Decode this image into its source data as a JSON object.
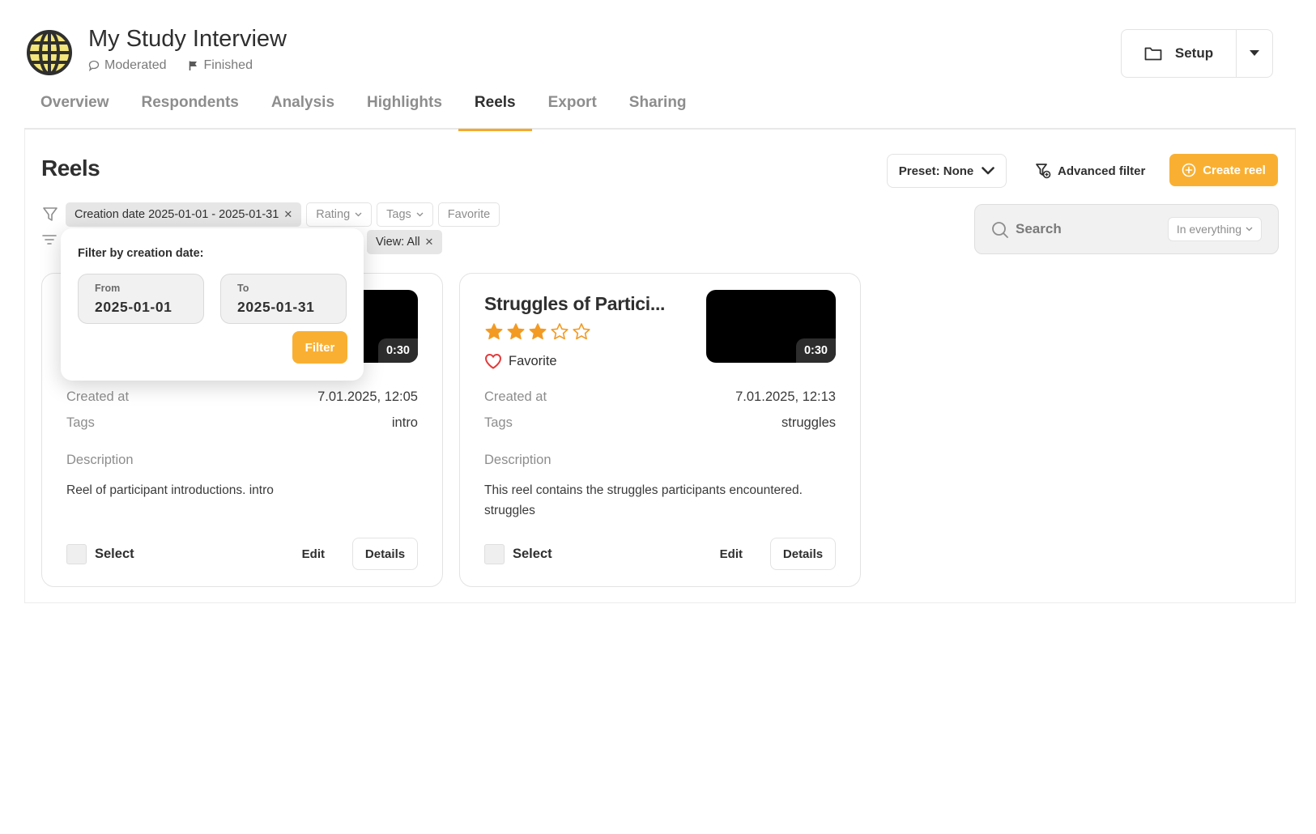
{
  "study": {
    "title": "My Study Interview",
    "mode": "Moderated",
    "status": "Finished",
    "setup_label": "Setup"
  },
  "tabs": [
    {
      "label": "Overview"
    },
    {
      "label": "Respondents"
    },
    {
      "label": "Analysis"
    },
    {
      "label": "Highlights"
    },
    {
      "label": "Reels",
      "active": true
    },
    {
      "label": "Export"
    },
    {
      "label": "Sharing"
    }
  ],
  "reels_page": {
    "heading": "Reels",
    "preset_label": "Preset: None",
    "advanced_filter_label": "Advanced filter",
    "create_label": "Create reel",
    "search": {
      "label": "Search",
      "scope": "In everything"
    },
    "filters": {
      "creation_date": "Creation date 2025-01-01 - 2025-01-31",
      "rating": "Rating",
      "tags": "Tags",
      "favorite": "Favorite",
      "view": "View: All"
    }
  },
  "popup": {
    "title": "Filter by creation date:",
    "from_label": "From",
    "from_value": "2025-01-01",
    "to_label": "To",
    "to_value": "2025-01-31",
    "filter_label": "Filter"
  },
  "labels": {
    "created_at": "Created at",
    "tags": "Tags",
    "description": "Description",
    "select": "Select",
    "edit": "Edit",
    "details": "Details",
    "favorite": "Favorite"
  },
  "reels": [
    {
      "duration": "0:30",
      "created_at": "7.01.2025, 12:05",
      "tags": "intro",
      "description": "Reel of participant introductions. intro"
    },
    {
      "title": "Struggles of Partici...",
      "rating": 3,
      "rating_max": 5,
      "favorite": true,
      "duration": "0:30",
      "created_at": "7.01.2025, 12:13",
      "tags": "struggles",
      "description": "This reel contains the struggles participants encountered. struggles"
    }
  ],
  "colors": {
    "accent": "#f9b032",
    "star": "#f39a22",
    "favorite_heart": "#e23b3b",
    "text": "#2f2f2f",
    "muted": "#8d8d8d"
  }
}
